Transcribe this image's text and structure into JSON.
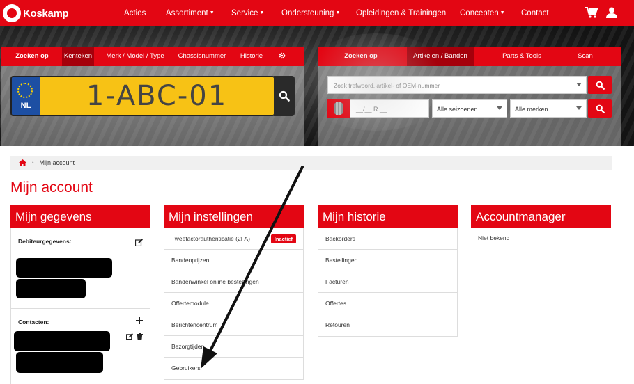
{
  "brand": {
    "name": "Koskamp"
  },
  "nav": {
    "items": [
      {
        "label": "Acties",
        "dropdown": false
      },
      {
        "label": "Assortiment",
        "dropdown": true
      },
      {
        "label": "Service",
        "dropdown": true
      },
      {
        "label": "Ondersteuning",
        "dropdown": true
      },
      {
        "label": "Opleidingen & Trainingen",
        "dropdown": false
      },
      {
        "label": "Concepten",
        "dropdown": true
      },
      {
        "label": "Contact",
        "dropdown": false
      }
    ],
    "icons": [
      "cart-icon",
      "user-icon"
    ]
  },
  "vehicle_search": {
    "tabs": [
      "Zoeken op",
      "Kenteken",
      "Merk / Model / Type",
      "Chassisnummer",
      "Historie"
    ],
    "active_tab": "Kenteken",
    "plate_country": "NL",
    "plate_value": "1-ABC-01"
  },
  "article_search": {
    "tabs": [
      "Zoeken op",
      "Artikelen / Banden",
      "Parts & Tools",
      "Scan"
    ],
    "active_tab": "Artikelen / Banden",
    "placeholder": "Zoek trefwoord, artikel- of OEM-nummer",
    "tire_placeholder": "__/__ R __",
    "season_value": "Alle seizoenen",
    "brand_value": "Alle merken"
  },
  "breadcrumb": {
    "current": "Mijn account"
  },
  "page_title": "Mijn account",
  "cards": {
    "gegevens": {
      "title": "Mijn gegevens",
      "debiteur_label": "Debiteurgegevens:",
      "contacten_label": "Contacten:"
    },
    "instellingen": {
      "title": "Mijn instellingen",
      "items": [
        {
          "label": "Tweefactorauthenticatie (2FA)",
          "badge": "Inactief"
        },
        {
          "label": "Bandenprijzen"
        },
        {
          "label": "Bandenwinkel online bestellingen"
        },
        {
          "label": "Offertemodule"
        },
        {
          "label": "Berichtencentrum"
        },
        {
          "label": "Bezorgtijden"
        },
        {
          "label": "Gebruikers"
        }
      ]
    },
    "historie": {
      "title": "Mijn historie",
      "items": [
        "Backorders",
        "Bestellingen",
        "Facturen",
        "Offertes",
        "Retouren"
      ]
    },
    "accountmanager": {
      "title": "Accountmanager",
      "value": "Niet bekend"
    }
  },
  "colors": {
    "brand_red": "#e30613",
    "dark_red": "#a5000b",
    "plate_yellow": "#f7c215",
    "eu_blue": "#1d4fa3"
  }
}
